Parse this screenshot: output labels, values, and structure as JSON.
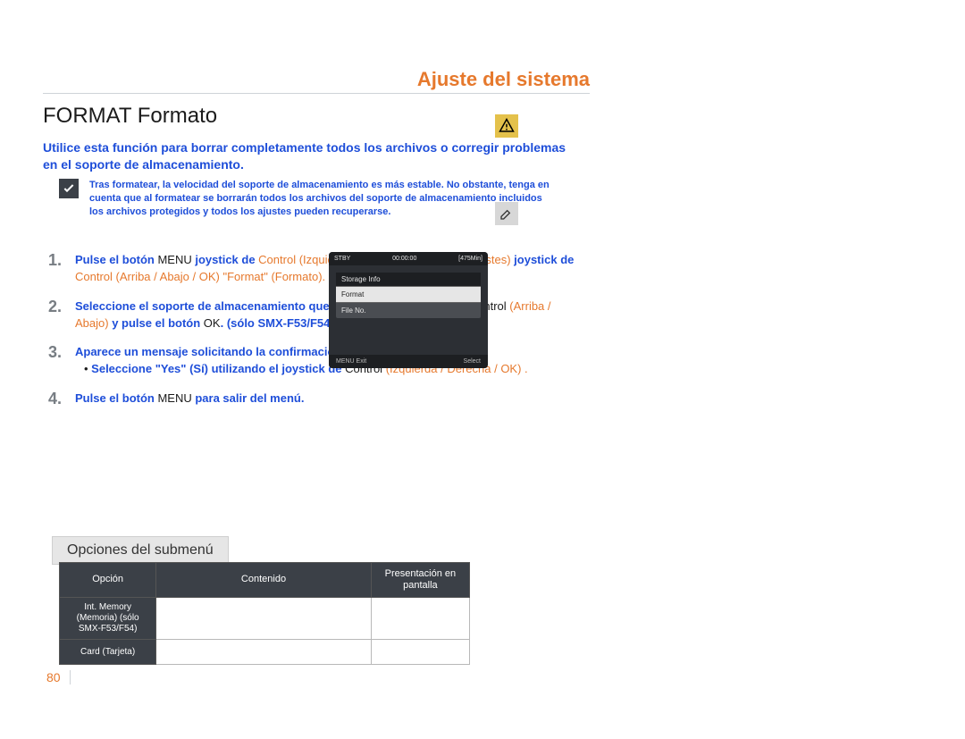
{
  "header": {
    "right_title": "Ajuste del sistema",
    "title": "FORMAT Formato"
  },
  "intro": "Utilice esta función para borrar completamente todos los archivos o corregir problemas en el soporte de almacenamiento.",
  "note": "Tras formatear, la velocidad del soporte de almacenamiento es más estable. No obstante, tenga en cuenta que al formatear se borrarán todos los archivos del soporte de almacenamiento incluidos los archivos protegidos y todos los ajustes pueden recuperarse.",
  "icons": {
    "check": "check-icon",
    "warning": "warning-icon",
    "edit": "edit-icon"
  },
  "steps": [
    {
      "num": "1.",
      "parts": [
        {
          "t": "Pulse el botón ",
          "c": "blue"
        },
        {
          "t": "MENU ",
          "c": "kw"
        },
        {
          "t": "joystick de ",
          "c": "blue"
        },
        {
          "t": "Control",
          "c": "orange"
        },
        {
          "t": " (",
          "c": "orange"
        },
        {
          "t": "Izquierda / Derecha",
          "c": "orange"
        },
        {
          "t": ") ",
          "c": "orange"
        },
        {
          "t": "\"Settings\" (Ajustes) ",
          "c": "orange"
        },
        {
          "t": "joystick de ",
          "c": "blue"
        },
        {
          "t": "Control",
          "c": "orange"
        },
        {
          "t": " (Arriba / Abajo / OK) ",
          "c": "orange"
        },
        {
          "t": "\"Format\" (Formato).",
          "c": "orange"
        }
      ]
    },
    {
      "num": "2.",
      "parts": [
        {
          "t": "Seleccione el soporte de almacenamiento que desee con el joystick de ",
          "c": "blue"
        },
        {
          "t": "Control",
          "c": "kw"
        },
        {
          "t": " (",
          "c": "orange"
        },
        {
          "t": "Arriba / Abajo",
          "c": "orange"
        },
        {
          "t": ") ",
          "c": "orange"
        },
        {
          "t": "y pulse el botón ",
          "c": "blue"
        },
        {
          "t": "OK",
          "c": "kw"
        },
        {
          "t": ". ",
          "c": "blue"
        },
        {
          "t": "(sólo SMX-F53/F54)",
          "c": "blue"
        }
      ]
    },
    {
      "num": "3.",
      "parts": [
        {
          "t": "Aparece un mensaje solicitando la confirmación.",
          "c": "blue"
        },
        {
          "t": "\n• ",
          "c": "kw"
        },
        {
          "t": "Seleccione \"Yes\" (Sí) utilizando el joystick de ",
          "c": "blue"
        },
        {
          "t": "Control",
          "c": "kw"
        },
        {
          "t": " (",
          "c": "orange"
        },
        {
          "t": "Izquierda / Derecha / OK",
          "c": "orange"
        },
        {
          "t": ") .",
          "c": "orange"
        }
      ]
    },
    {
      "num": "4.",
      "parts": [
        {
          "t": "Pulse el botón ",
          "c": "blue"
        },
        {
          "t": "MENU ",
          "c": "kw"
        },
        {
          "t": "para salir del menú.",
          "c": "blue"
        }
      ]
    }
  ],
  "screen": {
    "top_left": "STBY",
    "top_center": "00:00:00",
    "top_right": "[475Min]",
    "panel_header": "Storage Info",
    "rows": [
      "Format",
      "File No."
    ],
    "foot_left": "MENU Exit",
    "foot_right": "Select"
  },
  "submenu": {
    "tab": "Opciones del submenú",
    "cols": [
      "Opción",
      "Contenido",
      "Presentación en pantalla"
    ],
    "rows": [
      {
        "label": "Int. Memory (Memoria) (sólo SMX-F53/F54)"
      },
      {
        "label": "Card (Tarjeta)"
      }
    ]
  },
  "page_number": "80"
}
